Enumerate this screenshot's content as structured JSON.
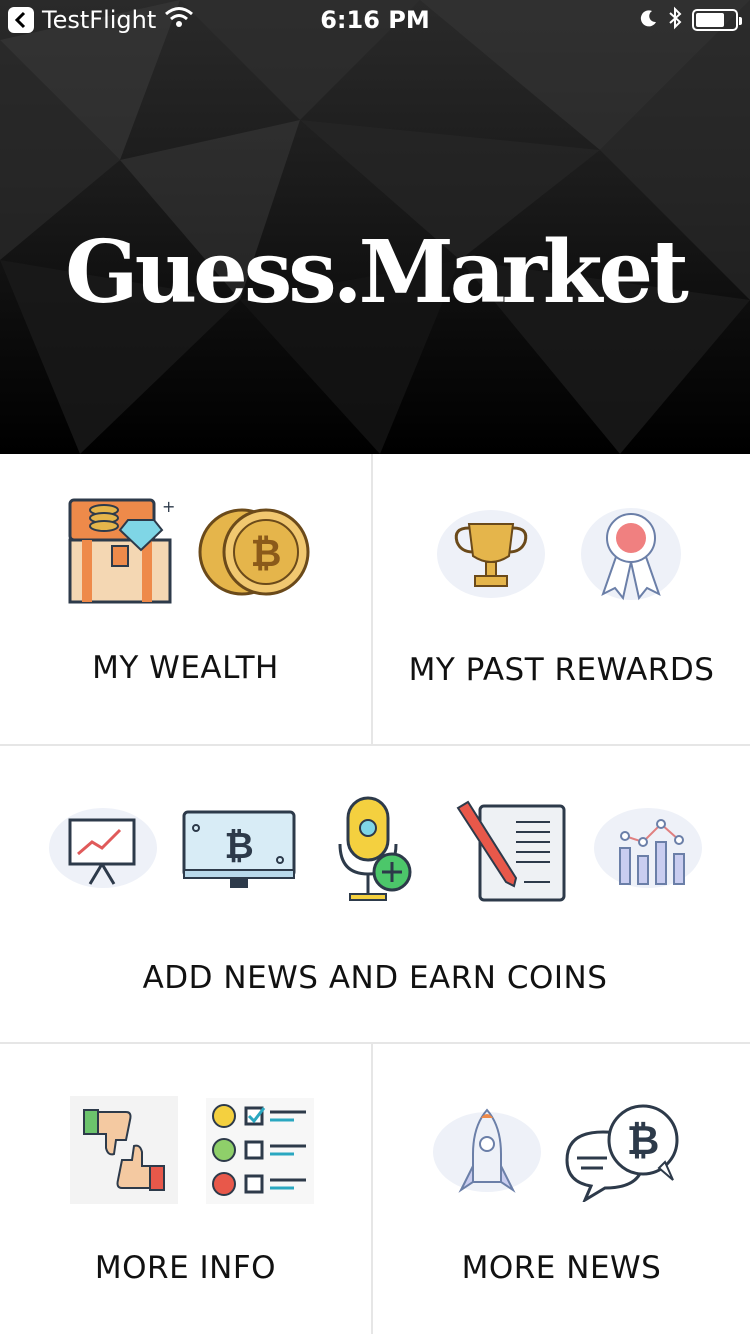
{
  "status_bar": {
    "back_app": "TestFlight",
    "time": "6:16 PM"
  },
  "hero": {
    "brand": "Guess.Market"
  },
  "tiles": {
    "wealth": {
      "label": "MY WEALTH"
    },
    "rewards": {
      "label": "MY PAST REWARDS"
    },
    "news": {
      "label": "ADD NEWS AND EARN COINS"
    },
    "info": {
      "label": "MORE INFO"
    },
    "more_news": {
      "label": "MORE NEWS"
    }
  },
  "icons": {
    "wealth": [
      "treasure-chest-icon",
      "bitcoin-coins-icon"
    ],
    "rewards": [
      "trophy-icon",
      "award-ribbon-icon"
    ],
    "news": [
      "presentation-chart-icon",
      "bitcoin-monitor-icon",
      "microphone-add-icon",
      "notepad-pen-icon",
      "bar-chart-icon"
    ],
    "info": [
      "thumbs-feedback-icon",
      "survey-checklist-icon"
    ],
    "more_news": [
      "rocket-icon",
      "bitcoin-chat-icon"
    ]
  },
  "colors": {
    "gold": "#e5b54b",
    "orange": "#ee8a4a",
    "teal": "#2aa7c0",
    "navy": "#2d3a4a",
    "hero_bg": "#111111"
  }
}
